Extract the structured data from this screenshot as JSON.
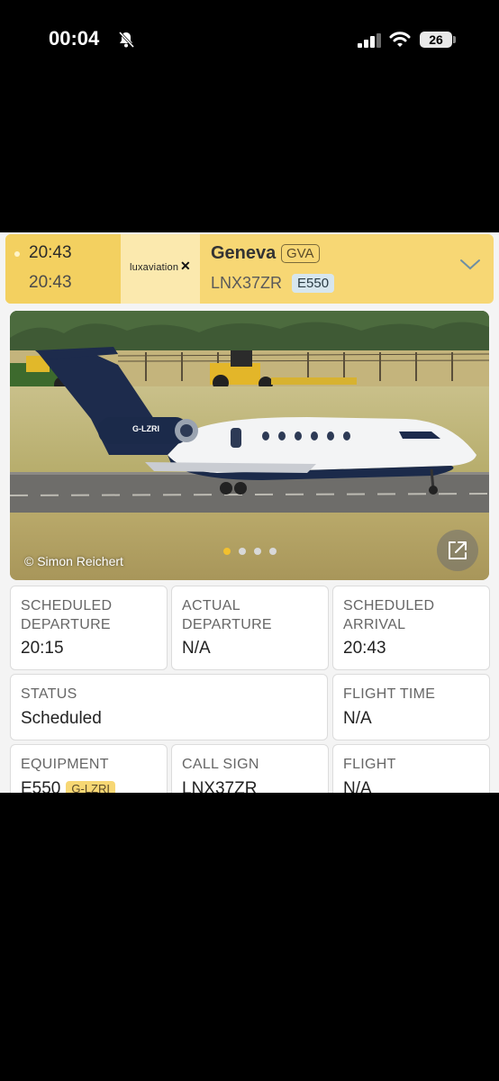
{
  "status_bar": {
    "time": "00:04",
    "battery": "26"
  },
  "flight": {
    "scheduled_time": "20:43",
    "estimated_time": "20:43",
    "airline": "luxaviation",
    "airline_mark": "✕",
    "destination": "Geneva",
    "destination_code": "GVA",
    "callsign": "LNX37ZR",
    "aircraft_type": "E550"
  },
  "photo": {
    "registration_painted": "G-LZRI",
    "credit": "© Simon Reichert",
    "carousel": {
      "count": 4,
      "active_index": 0
    }
  },
  "details": {
    "scheduled_departure": {
      "label": "Scheduled Departure",
      "value": "20:15"
    },
    "actual_departure": {
      "label": "Actual Departure",
      "value": "N/A"
    },
    "scheduled_arrival": {
      "label": "Scheduled Arrival",
      "value": "20:43"
    },
    "status": {
      "label": "Status",
      "value": "Scheduled"
    },
    "flight_time": {
      "label": "Flight Time",
      "value": "N/A"
    },
    "equipment": {
      "label": "Equipment",
      "value": "E550",
      "registration": "G-LZRI"
    },
    "call_sign": {
      "label": "Call Sign",
      "value": "LNX37ZR"
    },
    "flight_number": {
      "label": "Flight",
      "value": "N/A"
    }
  },
  "colors": {
    "accent": "#f7d774",
    "accent_dark": "#f3d060",
    "carousel_active": "#f2c02e",
    "type_badge": "#d7e6ee"
  },
  "icons": {
    "bell": "bell-slash-icon",
    "signal": "cellular-signal-icon",
    "wifi": "wifi-icon",
    "expand": "expand-arrow-icon",
    "chevron": "chevron-down-icon"
  }
}
